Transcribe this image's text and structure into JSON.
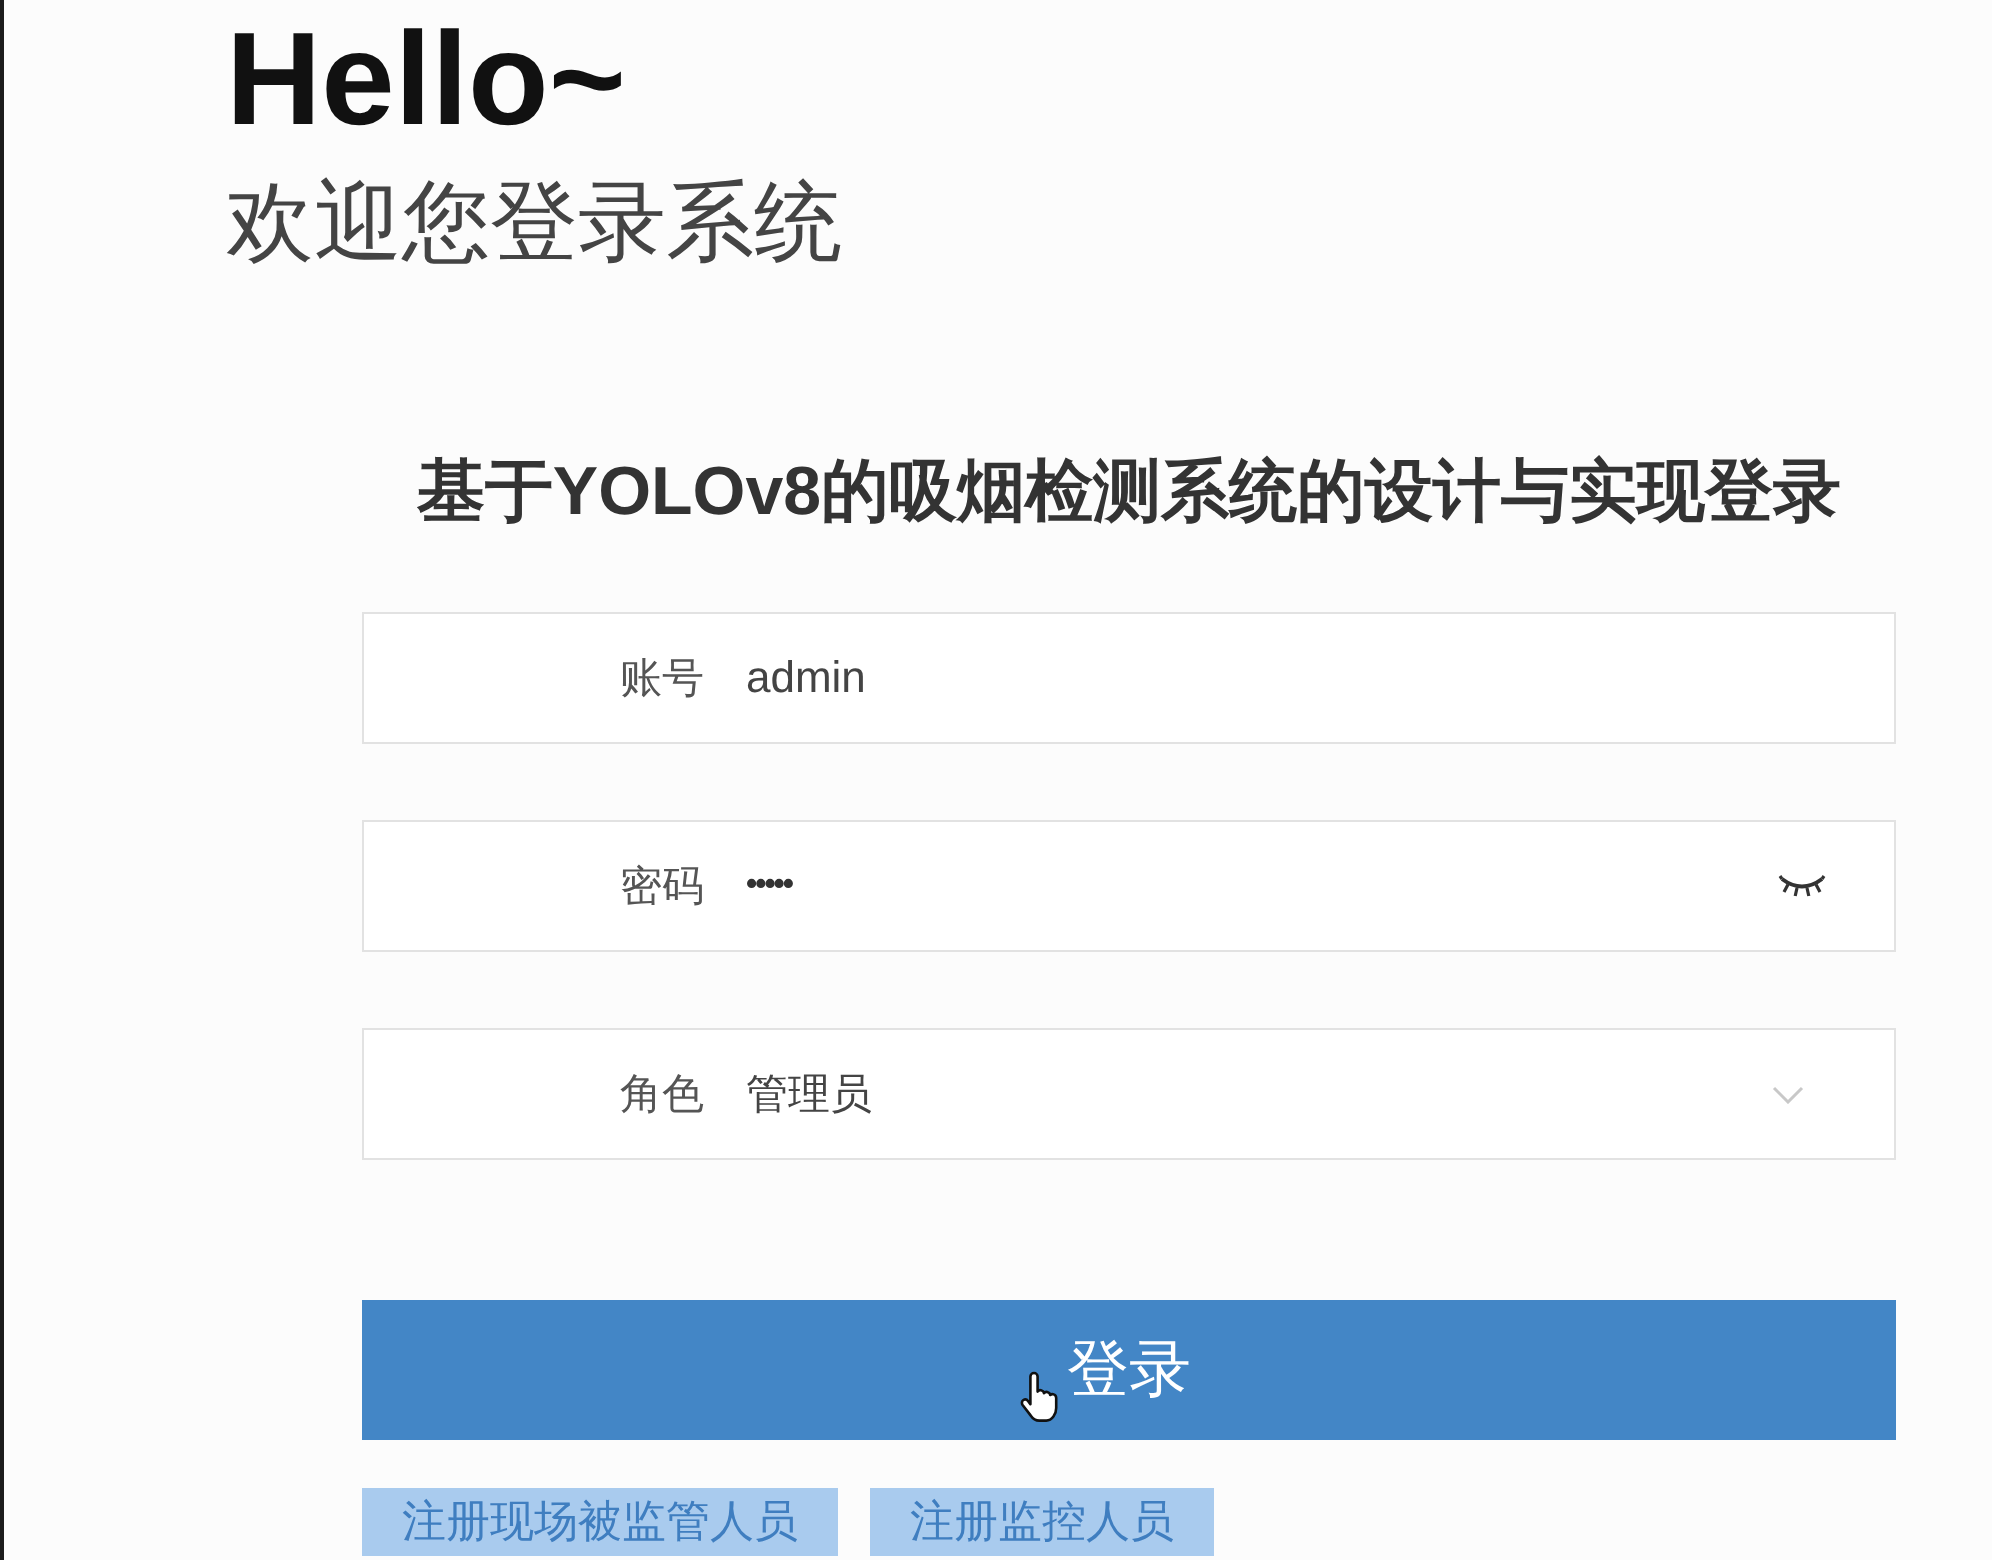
{
  "greeting": {
    "title": "Hello~",
    "subtitle": "欢迎您登录系统"
  },
  "form": {
    "title": "基于YOLOv8的吸烟检测系统的设计与实现登录",
    "fields": [
      {
        "kind": "text",
        "label": "账号",
        "value": "admin"
      },
      {
        "kind": "password",
        "label": "密码",
        "value": "•••••"
      },
      {
        "kind": "select",
        "label": "角色",
        "value": "管理员"
      }
    ],
    "submit": "登录",
    "links": [
      "注册现场被监管人员",
      "注册监控人员"
    ]
  }
}
